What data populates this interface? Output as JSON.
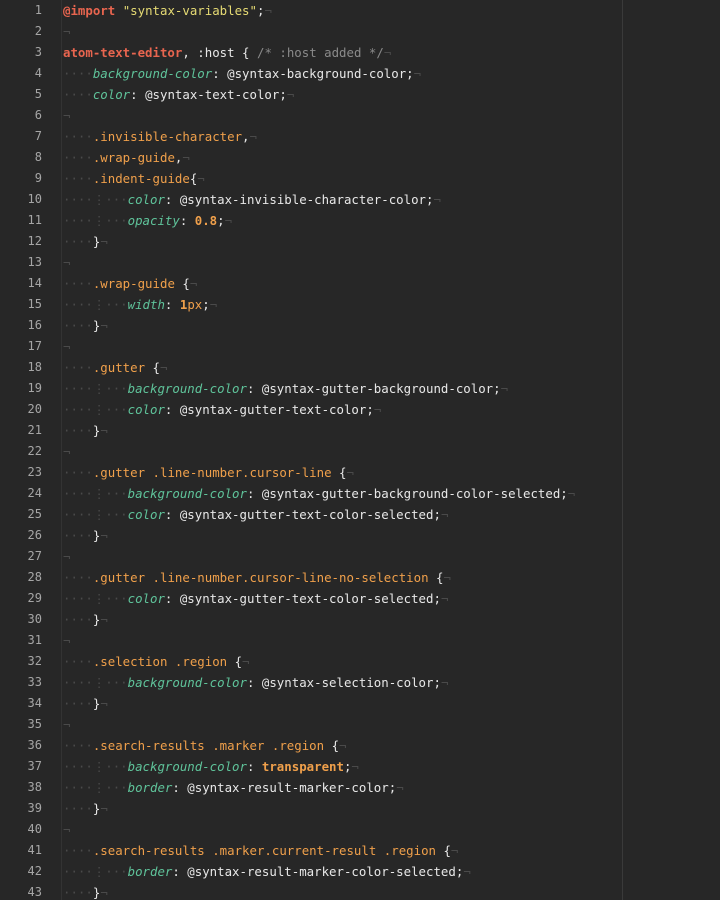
{
  "editor": {
    "lines": [
      {
        "n": "1",
        "tokens": [
          [
            "at-kw",
            "@import"
          ],
          [
            "punct",
            " "
          ],
          [
            "str",
            "\"syntax-variables\""
          ],
          [
            "punct",
            ";"
          ],
          [
            "invis",
            "¬"
          ]
        ]
      },
      {
        "n": "2",
        "tokens": [
          [
            "invis",
            "¬"
          ]
        ]
      },
      {
        "n": "3",
        "tokens": [
          [
            "sel-tag",
            "atom-text-editor"
          ],
          [
            "punct",
            ", "
          ],
          [
            "sel-pseudo",
            ":host"
          ],
          [
            "punct",
            " { "
          ],
          [
            "comment",
            "/* :host added */"
          ],
          [
            "invis",
            "¬"
          ]
        ]
      },
      {
        "n": "4",
        "tokens": [
          [
            "ig",
            "····"
          ],
          [
            "prop",
            "background-color"
          ],
          [
            "punct",
            ": "
          ],
          [
            "var",
            "@syntax-background-color"
          ],
          [
            "punct",
            ";"
          ],
          [
            "invis",
            "¬"
          ]
        ]
      },
      {
        "n": "5",
        "tokens": [
          [
            "ig",
            "····"
          ],
          [
            "prop",
            "color"
          ],
          [
            "punct",
            ": "
          ],
          [
            "var",
            "@syntax-text-color"
          ],
          [
            "punct",
            ";"
          ],
          [
            "invis",
            "¬"
          ]
        ]
      },
      {
        "n": "6",
        "tokens": [
          [
            "invis",
            "¬"
          ]
        ]
      },
      {
        "n": "7",
        "tokens": [
          [
            "ig",
            "····"
          ],
          [
            "sel-class",
            ".invisible-character"
          ],
          [
            "punct",
            ","
          ],
          [
            "invis",
            "¬"
          ]
        ]
      },
      {
        "n": "8",
        "tokens": [
          [
            "ig",
            "····"
          ],
          [
            "sel-class",
            ".wrap-guide"
          ],
          [
            "punct",
            ","
          ],
          [
            "invis",
            "¬"
          ]
        ]
      },
      {
        "n": "9",
        "tokens": [
          [
            "ig",
            "····"
          ],
          [
            "sel-class",
            ".indent-guide"
          ],
          [
            "punct",
            "{"
          ],
          [
            "invis",
            "¬"
          ]
        ]
      },
      {
        "n": "10",
        "tokens": [
          [
            "ig",
            "····⋮···"
          ],
          [
            "prop",
            "color"
          ],
          [
            "punct",
            ": "
          ],
          [
            "var",
            "@syntax-invisible-character-color"
          ],
          [
            "punct",
            ";"
          ],
          [
            "invis",
            "¬"
          ]
        ]
      },
      {
        "n": "11",
        "tokens": [
          [
            "ig",
            "····⋮···"
          ],
          [
            "prop",
            "opacity"
          ],
          [
            "punct",
            ": "
          ],
          [
            "num",
            "0.8"
          ],
          [
            "punct",
            ";"
          ],
          [
            "invis",
            "¬"
          ]
        ]
      },
      {
        "n": "12",
        "tokens": [
          [
            "ig",
            "····"
          ],
          [
            "punct",
            "}"
          ],
          [
            "invis",
            "¬"
          ]
        ]
      },
      {
        "n": "13",
        "tokens": [
          [
            "invis",
            "¬"
          ]
        ]
      },
      {
        "n": "14",
        "tokens": [
          [
            "ig",
            "····"
          ],
          [
            "sel-class",
            ".wrap-guide"
          ],
          [
            "punct",
            " {"
          ],
          [
            "invis",
            "¬"
          ]
        ]
      },
      {
        "n": "15",
        "tokens": [
          [
            "ig",
            "····⋮···"
          ],
          [
            "prop",
            "width"
          ],
          [
            "punct",
            ": "
          ],
          [
            "num",
            "1"
          ],
          [
            "unit",
            "px"
          ],
          [
            "punct",
            ";"
          ],
          [
            "invis",
            "¬"
          ]
        ]
      },
      {
        "n": "16",
        "tokens": [
          [
            "ig",
            "····"
          ],
          [
            "punct",
            "}"
          ],
          [
            "invis",
            "¬"
          ]
        ]
      },
      {
        "n": "17",
        "tokens": [
          [
            "invis",
            "¬"
          ]
        ]
      },
      {
        "n": "18",
        "tokens": [
          [
            "ig",
            "····"
          ],
          [
            "sel-class",
            ".gutter"
          ],
          [
            "punct",
            " {"
          ],
          [
            "invis",
            "¬"
          ]
        ]
      },
      {
        "n": "19",
        "tokens": [
          [
            "ig",
            "····⋮···"
          ],
          [
            "prop",
            "background-color"
          ],
          [
            "punct",
            ": "
          ],
          [
            "var",
            "@syntax-gutter-background-color"
          ],
          [
            "punct",
            ";"
          ],
          [
            "invis",
            "¬"
          ]
        ]
      },
      {
        "n": "20",
        "tokens": [
          [
            "ig",
            "····⋮···"
          ],
          [
            "prop",
            "color"
          ],
          [
            "punct",
            ": "
          ],
          [
            "var",
            "@syntax-gutter-text-color"
          ],
          [
            "punct",
            ";"
          ],
          [
            "invis",
            "¬"
          ]
        ]
      },
      {
        "n": "21",
        "tokens": [
          [
            "ig",
            "····"
          ],
          [
            "punct",
            "}"
          ],
          [
            "invis",
            "¬"
          ]
        ]
      },
      {
        "n": "22",
        "tokens": [
          [
            "invis",
            "¬"
          ]
        ]
      },
      {
        "n": "23",
        "tokens": [
          [
            "ig",
            "····"
          ],
          [
            "sel-class",
            ".gutter .line-number.cursor-line"
          ],
          [
            "punct",
            " {"
          ],
          [
            "invis",
            "¬"
          ]
        ]
      },
      {
        "n": "24",
        "tokens": [
          [
            "ig",
            "····⋮···"
          ],
          [
            "prop",
            "background-color"
          ],
          [
            "punct",
            ": "
          ],
          [
            "var",
            "@syntax-gutter-background-color-selected"
          ],
          [
            "punct",
            ";"
          ],
          [
            "invis",
            "¬"
          ]
        ]
      },
      {
        "n": "25",
        "tokens": [
          [
            "ig",
            "····⋮···"
          ],
          [
            "prop",
            "color"
          ],
          [
            "punct",
            ": "
          ],
          [
            "var",
            "@syntax-gutter-text-color-selected"
          ],
          [
            "punct",
            ";"
          ],
          [
            "invis",
            "¬"
          ]
        ]
      },
      {
        "n": "26",
        "tokens": [
          [
            "ig",
            "····"
          ],
          [
            "punct",
            "}"
          ],
          [
            "invis",
            "¬"
          ]
        ]
      },
      {
        "n": "27",
        "tokens": [
          [
            "invis",
            "¬"
          ]
        ]
      },
      {
        "n": "28",
        "tokens": [
          [
            "ig",
            "····"
          ],
          [
            "sel-class",
            ".gutter .line-number.cursor-line-no-selection"
          ],
          [
            "punct",
            " {"
          ],
          [
            "invis",
            "¬"
          ]
        ]
      },
      {
        "n": "29",
        "tokens": [
          [
            "ig",
            "····⋮···"
          ],
          [
            "prop",
            "color"
          ],
          [
            "punct",
            ": "
          ],
          [
            "var",
            "@syntax-gutter-text-color-selected"
          ],
          [
            "punct",
            ";"
          ],
          [
            "invis",
            "¬"
          ]
        ]
      },
      {
        "n": "30",
        "tokens": [
          [
            "ig",
            "····"
          ],
          [
            "punct",
            "}"
          ],
          [
            "invis",
            "¬"
          ]
        ]
      },
      {
        "n": "31",
        "tokens": [
          [
            "invis",
            "¬"
          ]
        ]
      },
      {
        "n": "32",
        "tokens": [
          [
            "ig",
            "····"
          ],
          [
            "sel-class",
            ".selection .region"
          ],
          [
            "punct",
            " {"
          ],
          [
            "invis",
            "¬"
          ]
        ]
      },
      {
        "n": "33",
        "tokens": [
          [
            "ig",
            "····⋮···"
          ],
          [
            "prop",
            "background-color"
          ],
          [
            "punct",
            ": "
          ],
          [
            "var",
            "@syntax-selection-color"
          ],
          [
            "punct",
            ";"
          ],
          [
            "invis",
            "¬"
          ]
        ]
      },
      {
        "n": "34",
        "tokens": [
          [
            "ig",
            "····"
          ],
          [
            "punct",
            "}"
          ],
          [
            "invis",
            "¬"
          ]
        ]
      },
      {
        "n": "35",
        "tokens": [
          [
            "invis",
            "¬"
          ]
        ]
      },
      {
        "n": "36",
        "tokens": [
          [
            "ig",
            "····"
          ],
          [
            "sel-class",
            ".search-results .marker .region"
          ],
          [
            "punct",
            " {"
          ],
          [
            "invis",
            "¬"
          ]
        ]
      },
      {
        "n": "37",
        "tokens": [
          [
            "ig",
            "····⋮···"
          ],
          [
            "prop",
            "background-color"
          ],
          [
            "punct",
            ": "
          ],
          [
            "kwv",
            "transparent"
          ],
          [
            "punct",
            ";"
          ],
          [
            "invis",
            "¬"
          ]
        ]
      },
      {
        "n": "38",
        "tokens": [
          [
            "ig",
            "····⋮···"
          ],
          [
            "prop",
            "border"
          ],
          [
            "punct",
            ": "
          ],
          [
            "var",
            "@syntax-result-marker-color"
          ],
          [
            "punct",
            ";"
          ],
          [
            "invis",
            "¬"
          ]
        ]
      },
      {
        "n": "39",
        "tokens": [
          [
            "ig",
            "····"
          ],
          [
            "punct",
            "}"
          ],
          [
            "invis",
            "¬"
          ]
        ]
      },
      {
        "n": "40",
        "tokens": [
          [
            "invis",
            "¬"
          ]
        ]
      },
      {
        "n": "41",
        "tokens": [
          [
            "ig",
            "····"
          ],
          [
            "sel-class",
            ".search-results .marker.current-result .region"
          ],
          [
            "punct",
            " {"
          ],
          [
            "invis",
            "¬"
          ]
        ]
      },
      {
        "n": "42",
        "tokens": [
          [
            "ig",
            "····⋮···"
          ],
          [
            "prop",
            "border"
          ],
          [
            "punct",
            ": "
          ],
          [
            "var",
            "@syntax-result-marker-color-selected"
          ],
          [
            "punct",
            ";"
          ],
          [
            "invis",
            "¬"
          ]
        ]
      },
      {
        "n": "43",
        "tokens": [
          [
            "ig",
            "····"
          ],
          [
            "punct",
            "}"
          ],
          [
            "invis",
            "¬"
          ]
        ]
      }
    ]
  },
  "colors": {
    "background": "#272727",
    "line_number": "#a6a6a6",
    "selector_tag": "#e8654f",
    "selector_class": "#f0a04b",
    "property": "#5fc39a",
    "string": "#e6db74",
    "comment": "#8a8a8a",
    "invisible": "#4a4a4a"
  }
}
